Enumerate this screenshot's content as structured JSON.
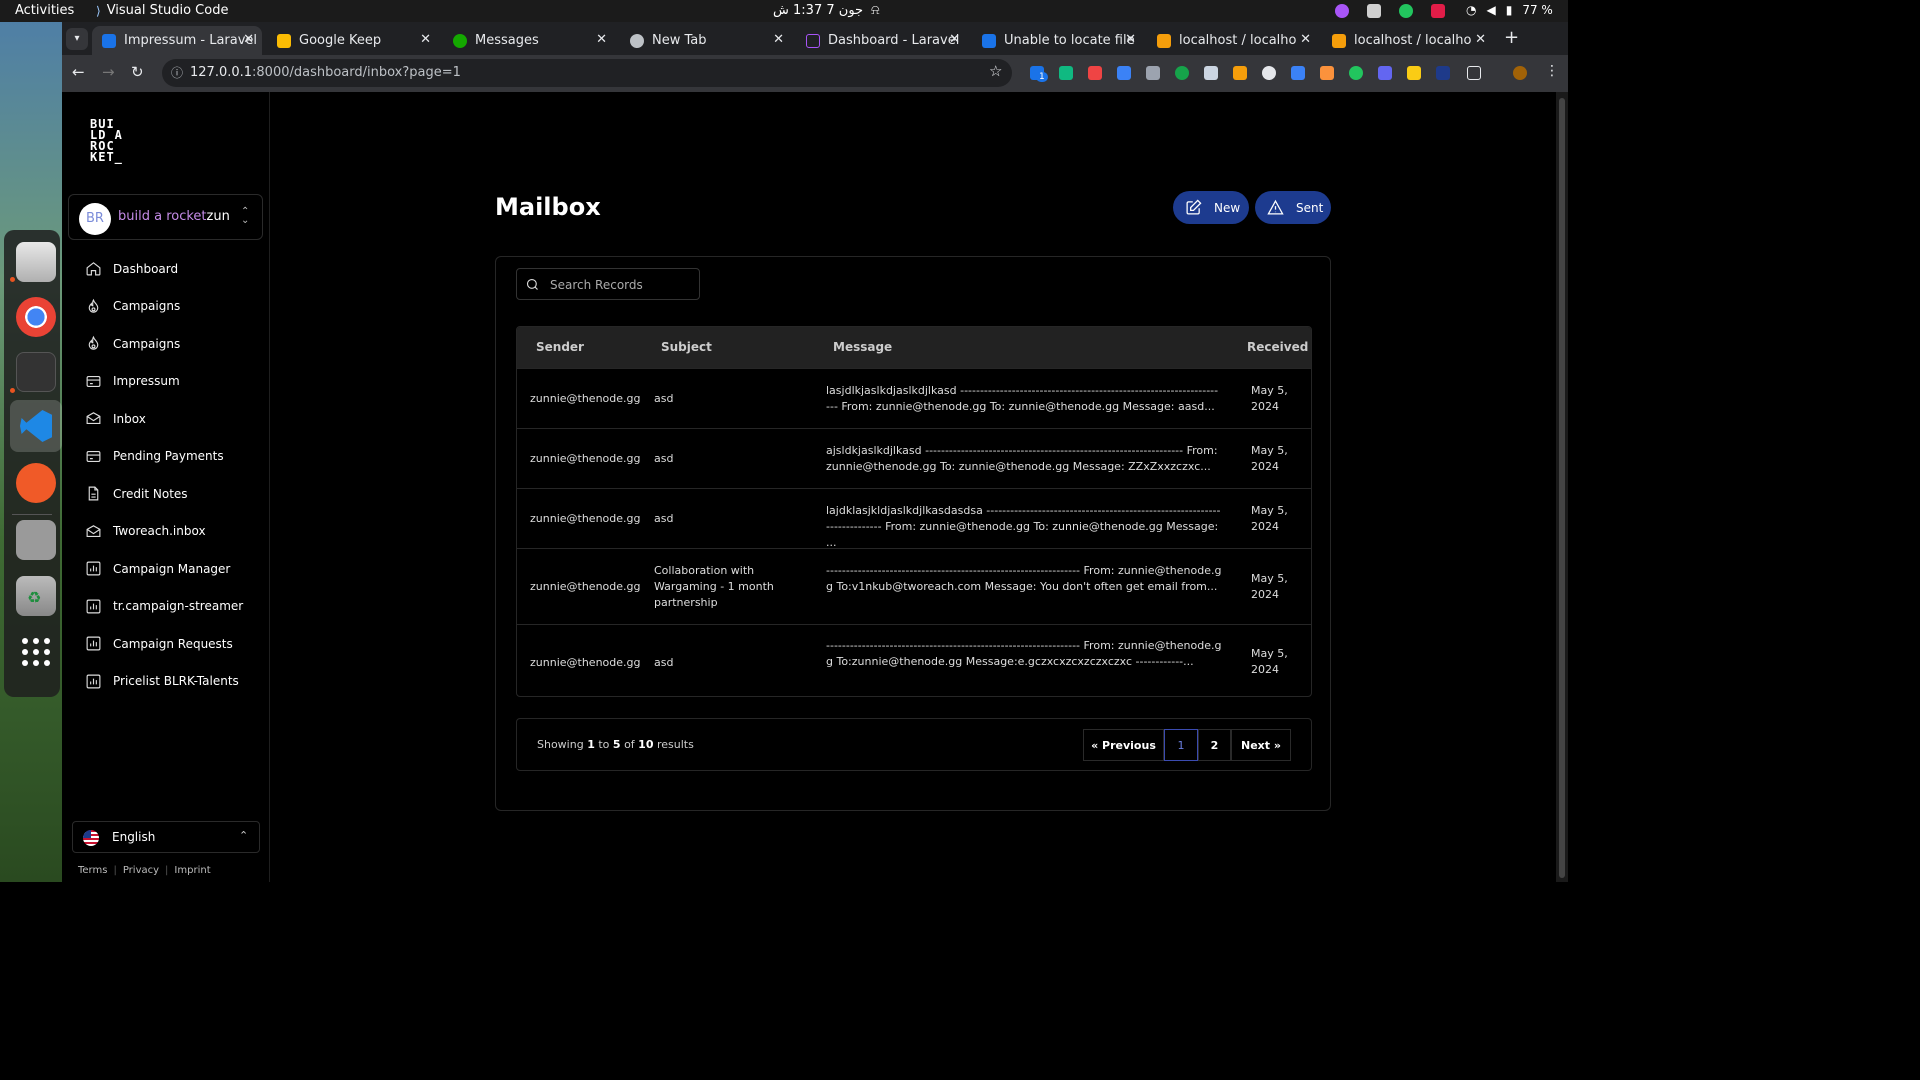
{
  "topbar": {
    "activities": "Activities",
    "app": "Visual Studio Code",
    "clock": "جون 7  1:37 ش",
    "battery": "77 %"
  },
  "browser": {
    "tabs": [
      {
        "title": "Impressum - Laravel",
        "active": true,
        "favicon_color": "#1a73e8"
      },
      {
        "title": "Google Keep",
        "active": false,
        "favicon_color": "#fbbc04"
      },
      {
        "title": "Messages",
        "active": false,
        "favicon_color": "#14a800"
      },
      {
        "title": "New Tab",
        "active": false,
        "favicon_color": "#bdc1c6"
      },
      {
        "title": "Dashboard - Laravel",
        "active": false,
        "favicon_color": "#7e22ce"
      },
      {
        "title": "Unable to locate file",
        "active": false,
        "favicon_color": "#1a73e8"
      },
      {
        "title": "localhost / localhost",
        "active": false,
        "favicon_color": "#f59e0b"
      },
      {
        "title": "localhost / localhost",
        "active": false,
        "favicon_color": "#f59e0b"
      }
    ],
    "url_host": "127.0.0.1",
    "url_rest": ":8000/dashboard/inbox?page=1",
    "extension_badge": "1"
  },
  "sidebar": {
    "logo_lines": [
      "BUI",
      "LD A",
      "ROC",
      "KET_"
    ],
    "avatar_initials": "BR",
    "team_name_accent": "build a rocket",
    "team_name_user": "zunnie",
    "items": [
      {
        "label": "Dashboard",
        "icon": "home-icon"
      },
      {
        "label": "Campaigns",
        "icon": "fire-icon"
      },
      {
        "label": "Campaigns",
        "icon": "fire-icon"
      },
      {
        "label": "Impressum",
        "icon": "card-icon"
      },
      {
        "label": "Inbox",
        "icon": "envelope-icon"
      },
      {
        "label": "Pending Payments",
        "icon": "card-icon"
      },
      {
        "label": "Credit Notes",
        "icon": "document-icon"
      },
      {
        "label": "Tworeach.inbox",
        "icon": "envelope-open-icon"
      },
      {
        "label": "Campaign Manager",
        "icon": "chart-icon"
      },
      {
        "label": "tr.campaign-streamer",
        "icon": "chart-icon"
      },
      {
        "label": "Campaign Requests",
        "icon": "chart-icon"
      },
      {
        "label": "Pricelist BLRK-Talents",
        "icon": "chart-icon"
      }
    ],
    "language": "English",
    "footer": {
      "terms": "Terms",
      "privacy": "Privacy",
      "imprint": "Imprint"
    }
  },
  "main": {
    "title": "Mailbox",
    "new_label": "New",
    "sent_label": "Sent",
    "search_placeholder": "Search Records",
    "columns": {
      "sender": "Sender",
      "subject": "Subject",
      "message": "Message",
      "received": "Received"
    },
    "rows": [
      {
        "sender": "zunnie@thenode.gg",
        "subject": "asd",
        "message": "lasjdlkjaslkdjaslkdjlkasd -------------------------------------------------------------------- From: zunnie@thenode.gg To: zunnie@thenode.gg Message: aasd...",
        "received": "May 5, 2024"
      },
      {
        "sender": "zunnie@thenode.gg",
        "subject": "asd",
        "message": "ajsldkjaslkdjlkasd ----------------------------------------------------------------- From: zunnie@thenode.gg To: zunnie@thenode.gg Message: ZZxZxxzczxc...",
        "received": "May 5, 2024"
      },
      {
        "sender": "zunnie@thenode.gg",
        "subject": "asd",
        "message": "lajdklasjkldjaslkdjlkasdasdsa ------------------------------------------------------------------------- From: zunnie@thenode.gg To: zunnie@thenode.gg Message: ...",
        "received": "May 5, 2024"
      },
      {
        "sender": "zunnie@thenode.gg",
        "subject": "Collaboration with Wargaming - 1 month partnership",
        "message": "---------------------------------------------------------------- From: zunnie@thenode.gg To:v1nkub@tworeach.com Message: You don't often get email from...",
        "received": "May 5, 2024"
      },
      {
        "sender": "zunnie@thenode.gg",
        "subject": "asd",
        "message": "---------------------------------------------------------------- From: zunnie@thenode.gg To:zunnie@thenode.gg Message:e.gczxcxzcxzczxczxc ------------...",
        "received": "May 5, 2024"
      }
    ],
    "pagination": {
      "prefix": "Showing",
      "from": "1",
      "to_word": "to",
      "to": "5",
      "of_word": "of",
      "total": "10",
      "suffix": "results",
      "previous": "« Previous",
      "pages": [
        "1",
        "2"
      ],
      "current_page": "1",
      "next": "Next »"
    }
  },
  "colors": {
    "accent_button": "#1d3b8f",
    "team_accent": "#c58ce8",
    "page_bg": "#000000"
  }
}
